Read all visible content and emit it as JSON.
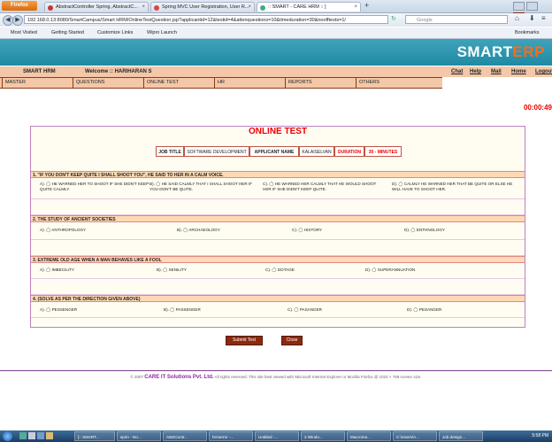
{
  "browser": {
    "firefox_label": "Firefox",
    "tabs": [
      {
        "label": "AbstractController Spring, AbstractC...",
        "icon": "java-icon"
      },
      {
        "label": "Spring MVC User Registration, User R...",
        "icon": "page-icon"
      },
      {
        "label": ":: SMART - CARE HRM :: ]",
        "icon": "smart-icon"
      }
    ],
    "new_tab": "+",
    "url": "192.168.0.13:8080/SmartCampus/Smart HRM/OnlineTestQuestion.jsp?applicantid=12&testid=4&attenquestions=10&timeduration=30&noofftests=1/",
    "search_placeholder": "Google",
    "bookmarks": [
      "Most Visited",
      "Getting Started",
      "Customize Links",
      "Wipro Launch"
    ],
    "bookmarks_right": "Bookmarks"
  },
  "header": {
    "app_name": "SMART HRM",
    "welcome": "Welcome :: HARIHARAN S",
    "logo_a": "SMART",
    "logo_b": "ERP",
    "links": [
      "Chat",
      "Help",
      "Mail",
      "Home",
      "Logout"
    ],
    "menu": [
      "MASTER",
      "QUESTIONS",
      "ONLINE TEST",
      "HR",
      "REPORTS",
      "OTHERS"
    ]
  },
  "timer": "00:00:49",
  "test": {
    "title": "ONLINE TEST",
    "job_title_label": "JOB TITLE",
    "job_title": "SOFTWARE DEVELOPMENT",
    "applicant_label": "APPLICANT NAME",
    "applicant": "KALAISELVAN",
    "duration_label": "DURATION",
    "duration": "30 - MINUTES",
    "questions": [
      {
        "text": "1. \"IF YOU DON'T KEEP QUITE I SHALL SHOOT YOU\", HE SAID TO HER IN A CALM VOICE.",
        "options": [
          "A). ◯ HE WARNED HER TO SHOOT IF SHE DIDN'T KEEP QUITE CALMLY.",
          "B). ◯ HE SAID CALMLY THAT I SHALL SHOOT HER IF YOU DON'T BE QUITE.",
          "C). ◯ HE WARNED HER CALMLY THAT HE WOULD SHOOT HER IF SHE DIDN'T KEEP QUITE.",
          "D). ◯ CALMLY HE WARNED HER THAT BE QUITE OR ELSE HE WILL HAVE TO SHOOT HER."
        ]
      },
      {
        "text": "2. THE STUDY OF ANCIENT SOCIETIES",
        "options": [
          "A). ◯ ANTHROPOLOGY",
          "B). ◯ ARCHAEOLOGY",
          "C). ◯ HISTORY",
          "D). ◯ ENTHNOLOGY"
        ]
      },
      {
        "text": "3. EXTREME OLD AGE WHEN A MAN BEHAVES LIKE A FOOL",
        "options": [
          "A). ◯ IMBECILITY",
          "B). ◯ SENILITY",
          "C). ◯ DOTAGE",
          "D). ◯ SUPERANNUATION"
        ]
      },
      {
        "text": "4. (SOLVE AS PER THE DIRECTION GIVEN ABOVE)",
        "options": [
          "A). ◯ PESSENGER",
          "B). ◯ PASSENGER",
          "C). ◯ PASANGER",
          "D). ◯ PESANGER"
        ]
      }
    ],
    "submit_label": "Submit Test",
    "close_label": "Close"
  },
  "footer": {
    "prefix": "© 2007",
    "company": "CARE IT Solutions Pvt. Ltd.",
    "suffix": "All rights reserved.  This site best viewed with Microsoft Internet Explorer or Mozilla Firefox @ 1024 × 768 screen size."
  },
  "taskbar": {
    "items": [
      "[:: SMART...",
      "sprin - No...",
      "ABSContr...",
      "hrmerror -...",
      "Untitled -...",
      "2 Windo...",
      "Macrome...",
      "C:\\Users\\A...",
      "Job design..."
    ],
    "clock": "5:58 PM"
  }
}
